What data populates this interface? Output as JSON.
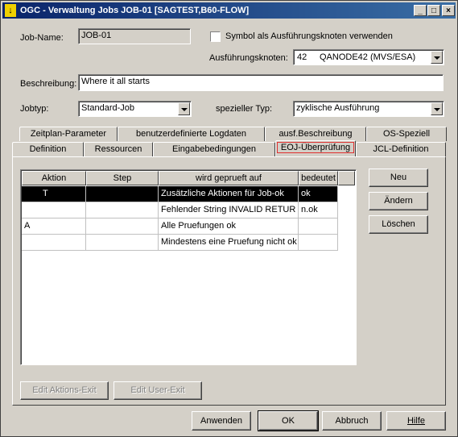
{
  "window": {
    "title": "OGC - Verwaltung Jobs JOB-01 [SAGTEST,B60-FLOW]"
  },
  "jobname": {
    "label": "Job-Name:",
    "value": "JOB-01"
  },
  "symbol_checkbox": {
    "label": "Symbol als Ausführungsknoten verwenden",
    "checked": false
  },
  "node": {
    "label": "Ausführungsknoten:",
    "number": "42",
    "name": "QANODE42 (MVS/ESA)"
  },
  "description": {
    "label": "Beschreibung:",
    "value": "Where it all starts"
  },
  "jobtype": {
    "label": "Jobtyp:",
    "value": "Standard-Job"
  },
  "special_type": {
    "label": "spezieller Typ:",
    "value": "zyklische Ausführung"
  },
  "tabs_row1": [
    "Zeitplan-Parameter",
    "benutzerdefinierte Logdaten",
    "ausf.Beschreibung",
    "OS-Speziell"
  ],
  "tabs_row2": [
    "Definition",
    "Ressourcen",
    "Eingabebedingungen",
    "EOJ-Überprüfung",
    "JCL-Definition"
  ],
  "active_tab": "EOJ-Überprüfung",
  "table": {
    "columns": [
      "Aktion",
      "Step",
      "wird geprueft auf",
      "bedeutet"
    ],
    "rows": [
      {
        "aktion": "T",
        "step": "",
        "check": "Zusätzliche Aktionen für Job-ok",
        "meaning": "ok",
        "selected": true
      },
      {
        "aktion": "",
        "step": "",
        "check": "Fehlender String INVALID RETUR",
        "meaning": "n.ok",
        "selected": false
      },
      {
        "aktion": "A",
        "step": "",
        "check": "Alle Pruefungen ok",
        "meaning": "",
        "selected": false
      },
      {
        "aktion": "",
        "step": "",
        "check": "Mindestens eine Pruefung nicht ok",
        "meaning": "",
        "selected": false
      }
    ]
  },
  "side_buttons": {
    "new": "Neu",
    "change": "Ändern",
    "delete": "Löschen"
  },
  "exit_buttons": {
    "action_exit": "Edit Aktions-Exit",
    "user_exit": "Edit User-Exit"
  },
  "footer_buttons": {
    "apply": "Anwenden",
    "ok": "OK",
    "cancel": "Abbruch",
    "help": "Hilfe"
  }
}
